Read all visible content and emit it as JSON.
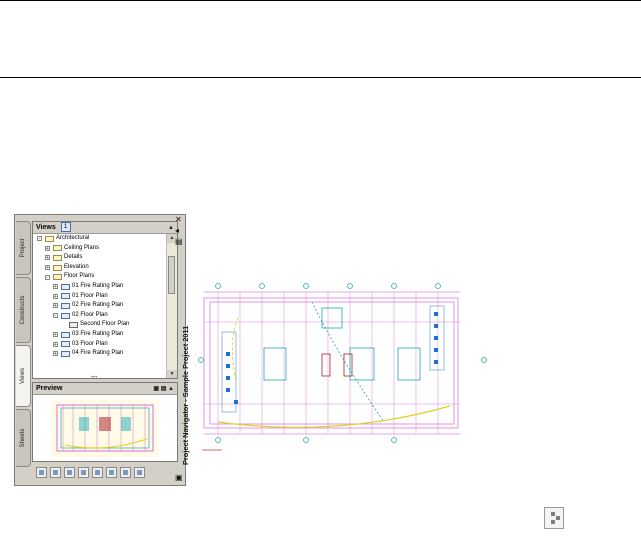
{
  "palette": {
    "title": "Project Navigator - Sample Project 2011",
    "tabs": [
      "Project",
      "Constructs",
      "Views",
      "Sheets"
    ],
    "active_tab": "Views",
    "views_panel": {
      "header": "Views",
      "badge": "1",
      "tree": [
        {
          "label": "Architectural",
          "level": 0,
          "toggle": "-",
          "icon": "folder"
        },
        {
          "label": "Ceiling Plans",
          "level": 1,
          "toggle": "+",
          "icon": "folder"
        },
        {
          "label": "Details",
          "level": 1,
          "toggle": "+",
          "icon": "folder"
        },
        {
          "label": "Elevation",
          "level": 1,
          "toggle": "+",
          "icon": "folder"
        },
        {
          "label": "Floor Plans",
          "level": 1,
          "toggle": "-",
          "icon": "folder"
        },
        {
          "label": "01 Fire Rating Plan",
          "level": 2,
          "toggle": "+",
          "icon": "view"
        },
        {
          "label": "01 Floor Plan",
          "level": 2,
          "toggle": "+",
          "icon": "view"
        },
        {
          "label": "02 Fire Rating Plan",
          "level": 2,
          "toggle": "+",
          "icon": "view"
        },
        {
          "label": "02 Floor Plan",
          "level": 2,
          "toggle": "-",
          "icon": "view"
        },
        {
          "label": "Second Floor Plan",
          "level": 3,
          "toggle": "",
          "icon": "sheet"
        },
        {
          "label": "03 Fire Rating Plan",
          "level": 2,
          "toggle": "+",
          "icon": "view"
        },
        {
          "label": "03 Floor Plan",
          "level": 2,
          "toggle": "+",
          "icon": "view"
        },
        {
          "label": "04 Fire Rating Plan",
          "level": 2,
          "toggle": "+",
          "icon": "view"
        }
      ]
    },
    "preview_panel": {
      "header": "Preview"
    },
    "toolbar_icons": [
      "new-view-icon",
      "new-category-icon",
      "add-view-icon",
      "delete-icon",
      "regenerate-icon",
      "properties-icon",
      "refresh-icon",
      "reposition-icon"
    ]
  },
  "colors": {
    "accent": "#4a6ea8",
    "panel": "#d4d0c8",
    "drawing_magenta": "#d24bd2",
    "drawing_cyan": "#1ea8b4"
  }
}
